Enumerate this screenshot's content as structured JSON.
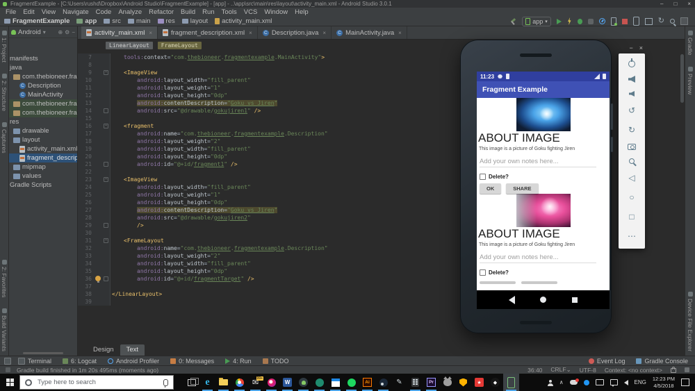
{
  "window": {
    "title": "FragmentExample - [C:\\Users\\rushd\\Dropbox\\Android Studio\\FragmentExample] - [app] - ..\\app\\src\\main\\res\\layout\\activity_main.xml - Android Studio 3.0.1",
    "controls": [
      "minimize",
      "maximize",
      "close"
    ]
  },
  "menu": [
    "File",
    "Edit",
    "View",
    "Navigate",
    "Code",
    "Analyze",
    "Refactor",
    "Build",
    "Run",
    "Tools",
    "VCS",
    "Window",
    "Help"
  ],
  "breadcrumbs": [
    {
      "label": "FragmentExample",
      "icon": "project-folder",
      "bold": true
    },
    {
      "label": "app",
      "icon": "module",
      "bold": true
    },
    {
      "label": "src",
      "icon": "folder"
    },
    {
      "label": "main",
      "icon": "folder"
    },
    {
      "label": "res",
      "icon": "res-folder"
    },
    {
      "label": "layout",
      "icon": "folder"
    },
    {
      "label": "activity_main.xml",
      "icon": "xml-file"
    }
  ],
  "toolbar": {
    "run_config_label": "app",
    "icons": [
      "build-hammer",
      "run-config",
      "run",
      "apply-changes",
      "debug",
      "coverage",
      "profiler",
      "attach-debugger",
      "stop",
      "avd-manager",
      "sdk-manager",
      "sync-project",
      "search-everywhere",
      "project-structure"
    ]
  },
  "left_stripe": {
    "top": [
      "1: Project",
      "2: Structure",
      "Captures"
    ],
    "bottom": [
      "2: Favorites",
      "Build Variants"
    ]
  },
  "right_stripe": {
    "top": [
      "Gradle",
      "Preview"
    ],
    "bottom": [
      "Device File Explorer"
    ]
  },
  "project": {
    "header": "Android",
    "tree": [
      {
        "label": "manifests",
        "icon": "none",
        "pad": 1
      },
      {
        "label": "java",
        "icon": "none",
        "pad": 1
      },
      {
        "label": "com.thebioneer.fragmentexa",
        "icon": "package",
        "pad": 6
      },
      {
        "label": "Description",
        "icon": "class",
        "pad": 15
      },
      {
        "label": "MainActivity",
        "icon": "class",
        "pad": 15
      },
      {
        "label": "com.thebioneer.fragmentex",
        "icon": "package",
        "pad": 6,
        "bg": "green"
      },
      {
        "label": "com.thebioneer.fragmentex",
        "icon": "package",
        "pad": 6,
        "bg": "green"
      },
      {
        "label": "res",
        "icon": "none",
        "pad": 1
      },
      {
        "label": "drawable",
        "icon": "folder",
        "pad": 6
      },
      {
        "label": "layout",
        "icon": "folder",
        "pad": 6
      },
      {
        "label": "activity_main.xml",
        "icon": "xml",
        "pad": 15
      },
      {
        "label": "fragment_description.xml",
        "icon": "xml",
        "pad": 15,
        "bg": "selected"
      },
      {
        "label": "mipmap",
        "icon": "folder",
        "pad": 6
      },
      {
        "label": "values",
        "icon": "folder",
        "pad": 6
      },
      {
        "label": "Gradle Scripts",
        "icon": "none",
        "pad": 1
      }
    ]
  },
  "editor": {
    "tabs": [
      {
        "label": "activity_main.xml",
        "icon": "xml",
        "selected": true
      },
      {
        "label": "fragment_description.xml",
        "icon": "xml"
      },
      {
        "label": "Description.java",
        "icon": "class"
      },
      {
        "label": "MainActivity.java",
        "icon": "class"
      }
    ],
    "chips": [
      {
        "label": "LinearLayout",
        "style": "gray"
      },
      {
        "label": "FrameLayout",
        "style": "olive"
      }
    ],
    "bottom_tabs": [
      {
        "label": "Design"
      },
      {
        "label": "Text",
        "selected": true
      }
    ],
    "lines": [
      {
        "n": 7,
        "i": 1,
        "parts": [
          [
            "a",
            "tools:"
          ],
          [
            "n",
            "context"
          ],
          [
            "p",
            "="
          ],
          [
            "s",
            "\"com."
          ],
          [
            "u",
            "thebioneer"
          ],
          [
            "s",
            "."
          ],
          [
            "u",
            "fragmentexample"
          ],
          [
            "s",
            ".MainActivity\""
          ],
          [
            "t",
            ">"
          ]
        ]
      },
      {
        "n": 8,
        "i": 0,
        "parts": []
      },
      {
        "n": 9,
        "i": 1,
        "fold": "start",
        "parts": [
          [
            "t",
            "<ImageView"
          ]
        ]
      },
      {
        "n": 10,
        "i": 2,
        "parts": [
          [
            "a",
            "android:"
          ],
          [
            "n",
            "layout_width"
          ],
          [
            "p",
            "="
          ],
          [
            "s",
            "\"fill_parent\""
          ]
        ]
      },
      {
        "n": 11,
        "i": 2,
        "parts": [
          [
            "a",
            "android:"
          ],
          [
            "n",
            "layout_weight"
          ],
          [
            "p",
            "="
          ],
          [
            "s",
            "\"1\""
          ]
        ]
      },
      {
        "n": 12,
        "i": 2,
        "parts": [
          [
            "a",
            "android:"
          ],
          [
            "n",
            "layout_height"
          ],
          [
            "p",
            "="
          ],
          [
            "s",
            "\"0dp\""
          ]
        ]
      },
      {
        "n": 13,
        "i": 2,
        "hl": true,
        "parts": [
          [
            "a",
            "android:"
          ],
          [
            "n",
            "contentDescription"
          ],
          [
            "p",
            "="
          ],
          [
            "s",
            "\""
          ],
          [
            "u",
            "Goku vs Jiren"
          ],
          [
            "s",
            "\""
          ]
        ]
      },
      {
        "n": 14,
        "i": 2,
        "fold": "end",
        "parts": [
          [
            "a",
            "android:"
          ],
          [
            "n",
            "src"
          ],
          [
            "p",
            "="
          ],
          [
            "s",
            "\"@drawable/"
          ],
          [
            "u",
            "gokujiren1"
          ],
          [
            "s",
            "\""
          ],
          [
            "t",
            " />"
          ]
        ]
      },
      {
        "n": 15,
        "i": 0,
        "parts": []
      },
      {
        "n": 16,
        "i": 1,
        "fold": "start",
        "parts": [
          [
            "t",
            "<fragment"
          ]
        ]
      },
      {
        "n": 17,
        "i": 2,
        "parts": [
          [
            "a",
            "android:"
          ],
          [
            "n",
            "name"
          ],
          [
            "p",
            "="
          ],
          [
            "s",
            "\"com."
          ],
          [
            "u",
            "thebioneer"
          ],
          [
            "s",
            "."
          ],
          [
            "u",
            "fragmentexample"
          ],
          [
            "s",
            ".Description\""
          ]
        ]
      },
      {
        "n": 18,
        "i": 2,
        "parts": [
          [
            "a",
            "android:"
          ],
          [
            "n",
            "layout_weight"
          ],
          [
            "p",
            "="
          ],
          [
            "s",
            "\"2\""
          ]
        ]
      },
      {
        "n": 19,
        "i": 2,
        "parts": [
          [
            "a",
            "android:"
          ],
          [
            "n",
            "layout_width"
          ],
          [
            "p",
            "="
          ],
          [
            "s",
            "\"fill_parent\""
          ]
        ]
      },
      {
        "n": 20,
        "i": 2,
        "parts": [
          [
            "a",
            "android:"
          ],
          [
            "n",
            "layout_height"
          ],
          [
            "p",
            "="
          ],
          [
            "s",
            "\"0dp\""
          ]
        ]
      },
      {
        "n": 21,
        "i": 2,
        "fold": "end",
        "parts": [
          [
            "a",
            "android:"
          ],
          [
            "n",
            "id"
          ],
          [
            "p",
            "="
          ],
          [
            "s",
            "\"@+id/"
          ],
          [
            "u",
            "fragment1"
          ],
          [
            "s",
            "\""
          ],
          [
            "t",
            " />"
          ]
        ]
      },
      {
        "n": 22,
        "i": 0,
        "parts": []
      },
      {
        "n": 23,
        "i": 1,
        "fold": "start",
        "parts": [
          [
            "t",
            "<ImageView"
          ]
        ]
      },
      {
        "n": 24,
        "i": 2,
        "parts": [
          [
            "a",
            "android:"
          ],
          [
            "n",
            "layout_width"
          ],
          [
            "p",
            "="
          ],
          [
            "s",
            "\"fill_parent\""
          ]
        ]
      },
      {
        "n": 25,
        "i": 2,
        "parts": [
          [
            "a",
            "android:"
          ],
          [
            "n",
            "layout_weight"
          ],
          [
            "p",
            "="
          ],
          [
            "s",
            "\"1\""
          ]
        ]
      },
      {
        "n": 26,
        "i": 2,
        "parts": [
          [
            "a",
            "android:"
          ],
          [
            "n",
            "layout_height"
          ],
          [
            "p",
            "="
          ],
          [
            "s",
            "\"0dp\""
          ]
        ]
      },
      {
        "n": 27,
        "i": 2,
        "hl": true,
        "parts": [
          [
            "a",
            "android:"
          ],
          [
            "n",
            "contentDescription"
          ],
          [
            "p",
            "="
          ],
          [
            "s",
            "\""
          ],
          [
            "u",
            "Goku vs Jiren"
          ],
          [
            "s",
            "\""
          ]
        ]
      },
      {
        "n": 28,
        "i": 2,
        "parts": [
          [
            "a",
            "android:"
          ],
          [
            "n",
            "src"
          ],
          [
            "p",
            "="
          ],
          [
            "s",
            "\"@drawable/"
          ],
          [
            "u",
            "gokujiren2"
          ],
          [
            "s",
            "\""
          ]
        ]
      },
      {
        "n": 29,
        "i": 2,
        "fold": "end",
        "parts": [
          [
            "t",
            "/>"
          ]
        ]
      },
      {
        "n": 30,
        "i": 0,
        "parts": []
      },
      {
        "n": 31,
        "i": 1,
        "fold": "start",
        "parts": [
          [
            "t",
            "<FrameLayout"
          ]
        ]
      },
      {
        "n": 32,
        "i": 2,
        "parts": [
          [
            "a",
            "android:"
          ],
          [
            "n",
            "name"
          ],
          [
            "p",
            "="
          ],
          [
            "s",
            "\"com."
          ],
          [
            "u",
            "thebioneer"
          ],
          [
            "s",
            "."
          ],
          [
            "u",
            "fragmentexample"
          ],
          [
            "s",
            ".Description\""
          ]
        ]
      },
      {
        "n": 33,
        "i": 2,
        "parts": [
          [
            "a",
            "android:"
          ],
          [
            "n",
            "layout_weight"
          ],
          [
            "p",
            "="
          ],
          [
            "s",
            "\"2\""
          ]
        ]
      },
      {
        "n": 34,
        "i": 2,
        "parts": [
          [
            "a",
            "android:"
          ],
          [
            "n",
            "layout_width"
          ],
          [
            "p",
            "="
          ],
          [
            "s",
            "\"fill_parent\""
          ]
        ]
      },
      {
        "n": 35,
        "i": 2,
        "parts": [
          [
            "a",
            "android:"
          ],
          [
            "n",
            "layout_height"
          ],
          [
            "p",
            "="
          ],
          [
            "s",
            "\"0dp\""
          ]
        ]
      },
      {
        "n": 36,
        "i": 2,
        "fold": "end",
        "bulb": true,
        "parts": [
          [
            "a",
            "android:"
          ],
          [
            "n",
            "id"
          ],
          [
            "p",
            "="
          ],
          [
            "s",
            "\"@+id/"
          ],
          [
            "u",
            "fragmentTarget"
          ],
          [
            "s",
            "\""
          ],
          [
            "t",
            " />"
          ]
        ]
      },
      {
        "n": 37,
        "i": 0,
        "parts": []
      },
      {
        "n": 38,
        "i": 0,
        "parts": [
          [
            "t",
            "</LinearLayout>"
          ]
        ]
      },
      {
        "n": 39,
        "i": 0,
        "parts": []
      }
    ]
  },
  "tool_window_bar": {
    "left": [
      {
        "label": "Terminal",
        "icon": "terminal"
      },
      {
        "label": "6: Logcat",
        "icon": "logcat"
      },
      {
        "label": "Android Profiler",
        "icon": "profiler"
      },
      {
        "label": "0: Messages",
        "icon": "messages"
      },
      {
        "label": "4: Run",
        "icon": "run"
      },
      {
        "label": "TODO",
        "icon": "todo"
      }
    ],
    "right": [
      {
        "label": "Event Log",
        "icon": "event-log"
      },
      {
        "label": "Gradle Console",
        "icon": "gradle-console"
      }
    ]
  },
  "status": {
    "message": "Gradle build finished in 1m 20s 495ms (moments ago)",
    "position": "36:40",
    "line_ending": "CRLF",
    "encoding": "UTF-8",
    "context": "Context: <no context>"
  },
  "emulator": {
    "time": "11:23",
    "app_title": "Fragment Example",
    "sections": [
      {
        "image": "goku-blue",
        "heading": "ABOUT IMAGE",
        "description": "This image is a picture of Goku fighting Jiren",
        "note_hint": "Add your own notes here...",
        "checkbox_label": "Delete?",
        "buttons": [
          "OK",
          "SHARE"
        ],
        "buttons_cut": false
      },
      {
        "image": "goku-pink",
        "heading": "ABOUT IMAGE",
        "description": "This image is a picture of Goku fighting Jiren",
        "note_hint": "Add your own notes here...",
        "checkbox_label": "Delete?",
        "buttons": [],
        "buttons_cut": true
      }
    ],
    "nav": [
      "back",
      "home",
      "overview"
    ],
    "toolbar": [
      "power",
      "volume-up",
      "volume-down",
      "rotate-left",
      "rotate-right",
      "screenshot",
      "zoom",
      "back",
      "home",
      "overview",
      "more"
    ],
    "toolbar_window": [
      "minimize",
      "close"
    ]
  },
  "taskbar": {
    "search_placeholder": "Type here to search",
    "pinned": [
      {
        "name": "task-view",
        "open": false
      },
      {
        "name": "edge",
        "open": true,
        "glyph": "e"
      },
      {
        "name": "file-explorer",
        "open": true
      },
      {
        "name": "chrome",
        "open": true
      },
      {
        "name": "mail",
        "open": true,
        "badge": "99+"
      },
      {
        "name": "paint",
        "open": true
      },
      {
        "name": "word",
        "open": true,
        "glyph": "W"
      },
      {
        "name": "android-studio",
        "open": true
      },
      {
        "name": "green-app",
        "open": true
      },
      {
        "name": "calendar",
        "open": true
      },
      {
        "name": "spotify",
        "open": true
      },
      {
        "name": "illustrator",
        "open": true,
        "glyph": "Ai"
      },
      {
        "name": "steam",
        "open": true
      },
      {
        "name": "pen-tool",
        "open": false,
        "glyph": "✎"
      },
      {
        "name": "calculator",
        "open": true
      },
      {
        "name": "premiere",
        "open": true,
        "glyph": "Pr"
      },
      {
        "name": "cat-app",
        "open": false
      },
      {
        "name": "shield-app",
        "open": false
      },
      {
        "name": "red-app",
        "open": false,
        "glyph": "★"
      },
      {
        "name": "unity",
        "open": false,
        "glyph": "◆"
      },
      {
        "name": "android-emulator",
        "open": true,
        "active": true
      }
    ],
    "tray": [
      "people",
      "chevron-up",
      "cloud-error",
      "bluetooth",
      "touch-keyboard",
      "chat",
      "volume"
    ],
    "language": "ENG",
    "time": "12:23 PM",
    "date": "4/5/2018"
  }
}
